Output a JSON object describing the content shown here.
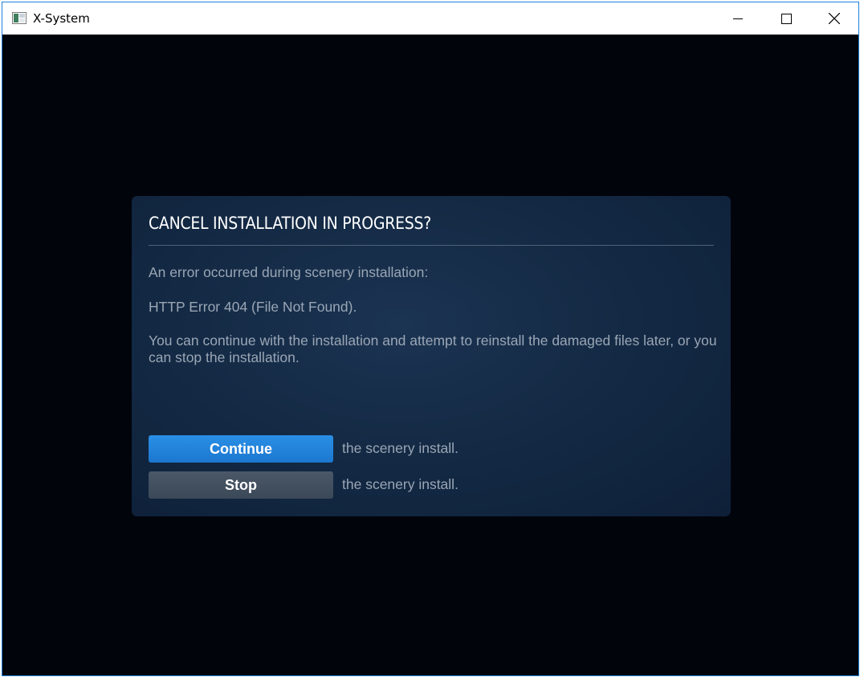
{
  "window": {
    "title": "X-System"
  },
  "dialog": {
    "title": "CANCEL INSTALLATION IN PROGRESS?",
    "message_line1": "An error occurred during scenery installation:",
    "message_line2": "HTTP Error 404 (File Not Found).",
    "message_line3": "You can continue with the installation and attempt to reinstall the damaged files later, or you can stop the installation.",
    "continue_label": "Continue",
    "continue_suffix": "the scenery install.",
    "stop_label": "Stop",
    "stop_suffix": "the scenery install."
  },
  "colors": {
    "content_bg": "#02040c",
    "dialog_bg": "#142a45",
    "continue_button": "#1c77cf",
    "stop_button": "#3b4857",
    "window_border": "#1e7fd8"
  },
  "icons": {
    "app": "app-window-icon",
    "minimize": "minimize-icon",
    "maximize": "maximize-icon",
    "close": "close-icon"
  }
}
